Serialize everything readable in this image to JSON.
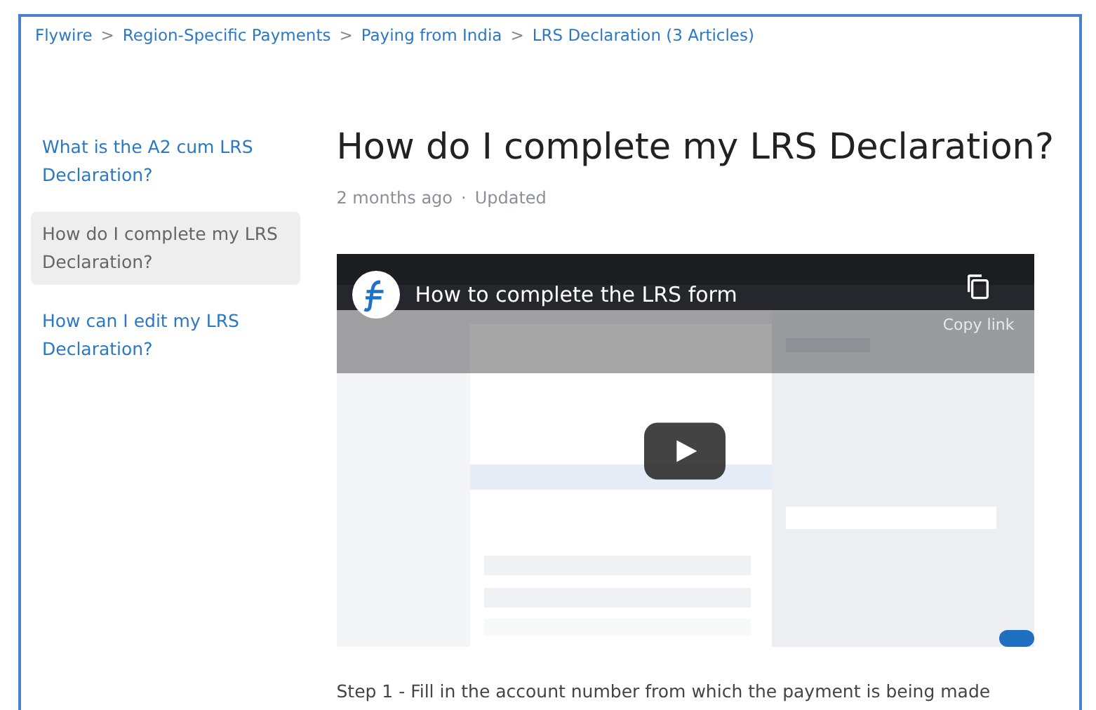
{
  "breadcrumbs": [
    {
      "label": "Flywire"
    },
    {
      "label": "Region-Specific Payments"
    },
    {
      "label": "Paying from India"
    },
    {
      "label": "LRS Declaration (3 Articles)"
    }
  ],
  "breadcrumb_separator": ">",
  "sidebar": {
    "items": [
      {
        "label": "What is the A2 cum LRS Declaration?",
        "selected": false
      },
      {
        "label": "How do I complete my LRS Declaration?",
        "selected": true
      },
      {
        "label": "How can I edit my LRS Declaration?",
        "selected": false
      }
    ]
  },
  "article": {
    "title": "How do I complete my LRS Declaration?",
    "age": "2 months ago",
    "meta_separator": "·",
    "status": "Updated",
    "video": {
      "kind": "picture",
      "title": "How to complete the LRS form",
      "copy_label": "Copy link"
    },
    "step": "Step 1 - Fill in the account number from which the payment is being made"
  }
}
